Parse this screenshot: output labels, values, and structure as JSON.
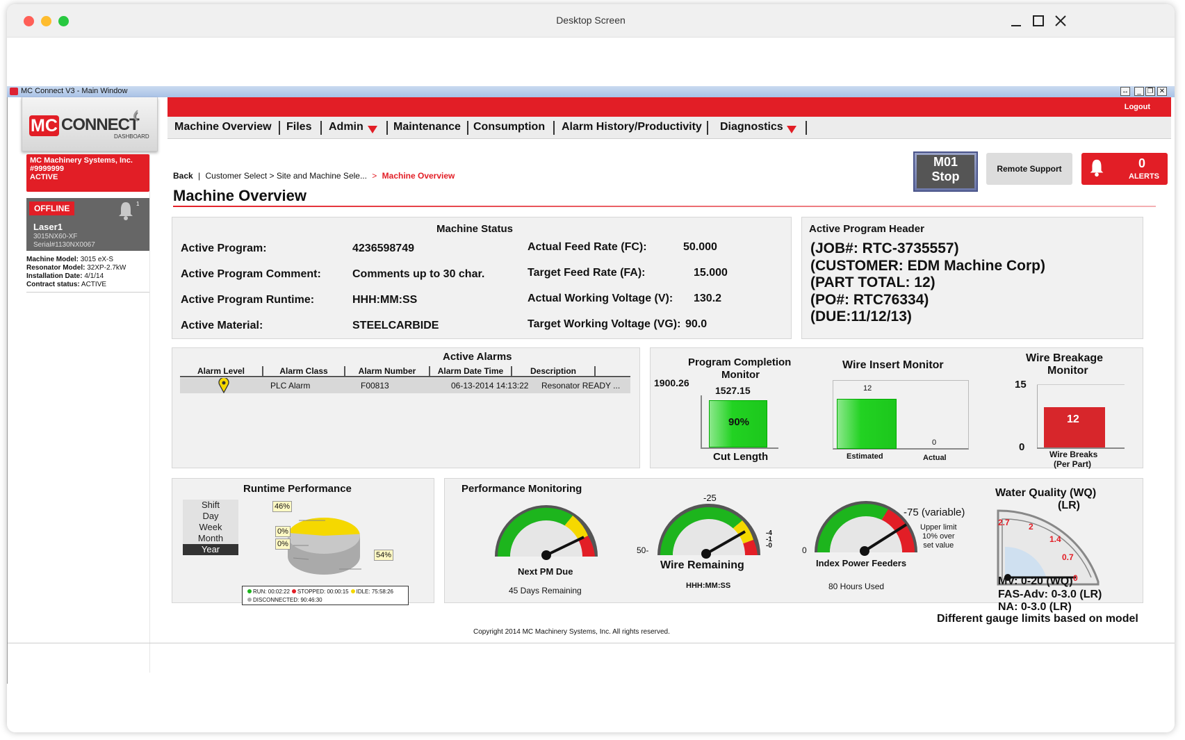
{
  "window": {
    "title": "Desktop Screen"
  },
  "app": {
    "title": "MC Connect V3 - Main Window"
  },
  "logo": {
    "mc": "MC",
    "connect": "CONNECT",
    "dashboard": "DASHBOARD"
  },
  "nav": {
    "items": [
      "Machine Overview",
      "Files",
      "Admin",
      "Maintenance",
      "Consumption",
      "Alarm History/Productivity",
      "Diagnostics"
    ],
    "logout": "Logout"
  },
  "sidebar": {
    "company": {
      "name": "MC Machinery Systems, Inc.",
      "id": "#9999999",
      "status": "ACTIVE"
    },
    "machine": {
      "status_badge": "OFFLINE",
      "notif_count": "1",
      "name": "Laser1",
      "model_line": "3015NX60-XF",
      "serial": "Serial#1130NX0067"
    },
    "details": [
      {
        "label": "Machine Model:",
        "value": "3015 eX-S"
      },
      {
        "label": "Resonator Model:",
        "value": "32XP-2.7kW"
      },
      {
        "label": "Installation Date:",
        "value": "4/1/14"
      },
      {
        "label": "Contract status:",
        "value": "ACTIVE"
      }
    ]
  },
  "breadcrumb": {
    "back": "Back",
    "path": "Customer Select > Site and Machine Sele...",
    "arrow": ">",
    "current": "Machine Overview"
  },
  "page_title": "Machine Overview",
  "topright": {
    "m01_line1": "M01",
    "m01_line2": "Stop",
    "remote": "Remote Support",
    "alerts_count": "0",
    "alerts_label": "ALERTS"
  },
  "machine_status": {
    "title": "Machine Status",
    "left": [
      {
        "label": "Active Program:",
        "value": "4236598749"
      },
      {
        "label": "Active Program Comment:",
        "value": "Comments up to 30 char."
      },
      {
        "label": "Active Program Runtime:",
        "value": "HHH:MM:SS"
      },
      {
        "label": "Active Material:",
        "value": "STEELCARBIDE"
      }
    ],
    "right": [
      {
        "label": "Actual Feed Rate (FC):",
        "value": "50.000"
      },
      {
        "label": "Target Feed Rate (FA):",
        "value": "15.000"
      },
      {
        "label": "Actual Working Voltage (V):",
        "value": "130.2"
      },
      {
        "label": "Target Working Voltage (VG):",
        "value": "90.0"
      }
    ]
  },
  "program_header": {
    "title": "Active Program Header",
    "lines": [
      "(JOB#: RTC-3735557)",
      "(CUSTOMER: EDM Machine Corp)",
      "(PART TOTAL: 12)",
      "(PO#: RTC76334)",
      "(DUE:11/12/13)"
    ]
  },
  "alarms": {
    "title": "Active Alarms",
    "columns": [
      "Alarm Level",
      "Alarm Class",
      "Alarm Number",
      "Alarm Date Time",
      "Description"
    ],
    "rows": [
      {
        "class": "PLC Alarm",
        "number": "F00813",
        "datetime": "06-13-2014 14:13:22",
        "description": "Resonator READY ..."
      }
    ]
  },
  "program_completion": {
    "title_line1": "Program Completion",
    "title_line2": "Monitor",
    "max_label": "1900.26",
    "current_label": "1527.15",
    "percent_label": "90%",
    "xlabel": "Cut Length",
    "percent": 90
  },
  "wire_insert": {
    "title": "Wire Insert Monitor",
    "bars": [
      {
        "label": "Estimated",
        "value": 12
      },
      {
        "label": "Actual",
        "value": 0
      }
    ],
    "value_labels": [
      "12",
      "0"
    ]
  },
  "wire_breakage": {
    "title_line1": "Wire Breakage",
    "title_line2": "Monitor",
    "ymax_label": "15",
    "ymin_label": "0",
    "value_label": "12",
    "xlabel_line1": "Wire Breaks",
    "xlabel_line2": "(Per Part)",
    "value": 12,
    "max": 15
  },
  "runtime": {
    "title": "Runtime Performance",
    "periods": [
      "Shift",
      "Day",
      "Week",
      "Month",
      "Year"
    ],
    "selected": "Year",
    "pie_labels": [
      "46%",
      "0%",
      "0%",
      "54%"
    ],
    "legend_line1": [
      {
        "label": "RUN: 00:02:22",
        "color": "#1db51d"
      },
      {
        "label": "STOPPED: 00:00:15",
        "color": "#e21e26"
      },
      {
        "label": "IDLE: 75:58:26",
        "color": "#f5d800"
      }
    ],
    "legend_line2": [
      {
        "label": "DISCONNECTED: 90:46:30",
        "color": "#aaaaaa"
      }
    ],
    "colors": {
      "run": "#f5d800",
      "other": "#c4c4c4"
    }
  },
  "performance": {
    "title": "Performance Monitoring",
    "gauges": [
      {
        "label": "Next PM Due",
        "sublabel": "45 Days Remaining"
      },
      {
        "label": "Wire Remaining",
        "sublabel": "HHH:MM:SS",
        "scale_top": "-25",
        "scale_left": "50-",
        "scale_right": [
          "-4",
          "-1",
          "-0"
        ]
      },
      {
        "label": "Index Power Feeders",
        "sublabel": "80 Hours Used",
        "scale_left": "0",
        "scale_top_right": "-75 (variable)",
        "note": [
          "Upper limit",
          "10% over",
          "set value"
        ]
      }
    ]
  },
  "water_quality": {
    "title_line1": "Water Quality (WQ)",
    "title_line2": "(LR)",
    "ticks": [
      "2.7",
      "2",
      "1.4",
      "0.7",
      "0"
    ],
    "notes": [
      "MV: 0-20 (WQ)",
      "FAS-Adv: 0-3.0 (LR)",
      "NA: 0-3.0 (LR)",
      "Different gauge limits based on model"
    ]
  },
  "footer": {
    "copyright": "Copyright 2014 MC Machinery Systems, Inc. All rights reserved."
  }
}
